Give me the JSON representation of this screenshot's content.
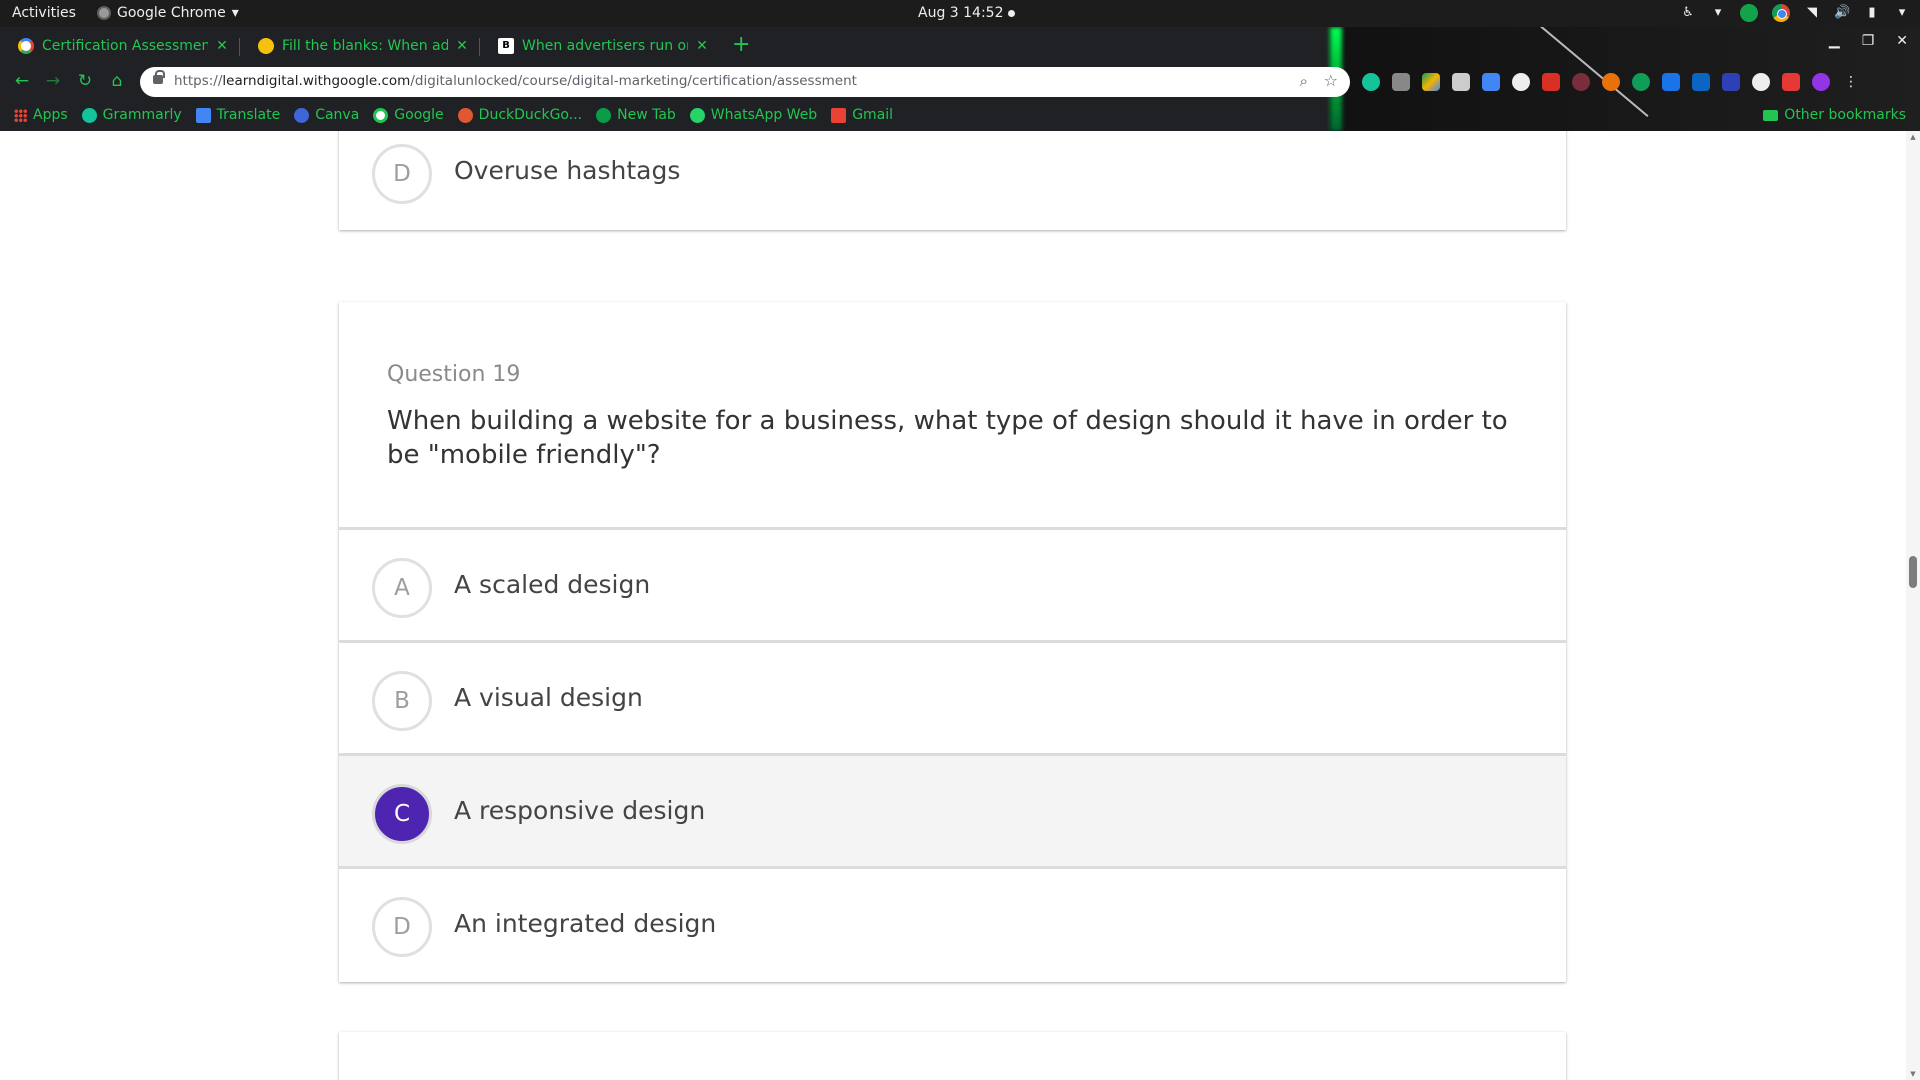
{
  "system_bar": {
    "activities": "Activities",
    "app_name": "Google Chrome",
    "clock": "Aug 3  14:52"
  },
  "browser": {
    "tabs": [
      {
        "title": "Certification Assessment",
        "favicon": "google-icon"
      },
      {
        "title": "Fill the blanks: When adv",
        "favicon": "yellow-circle-icon"
      },
      {
        "title": "When advertisers run onl",
        "favicon": "b-icon"
      }
    ],
    "url": {
      "scheme": "https://",
      "host": "learndigital.withgoogle.com",
      "path": "/digitalunlocked/course/digital-marketing/certification/assessment"
    },
    "bookmarks": [
      {
        "label": "Apps",
        "icon": "apps-grid-icon"
      },
      {
        "label": "Grammarly",
        "icon": "grammarly-icon"
      },
      {
        "label": "Translate",
        "icon": "translate-icon"
      },
      {
        "label": "Canva",
        "icon": "canva-icon"
      },
      {
        "label": "Google",
        "icon": "google-icon"
      },
      {
        "label": "DuckDuckGo...",
        "icon": "duckduckgo-icon"
      },
      {
        "label": "New Tab",
        "icon": "new-tab-icon"
      },
      {
        "label": "WhatsApp Web",
        "icon": "whatsapp-icon"
      },
      {
        "label": "Gmail",
        "icon": "gmail-icon"
      }
    ],
    "other_bookmarks": "Other bookmarks",
    "accent_color": "#23c552"
  },
  "quiz": {
    "previous_option": {
      "letter": "D",
      "text": "Overuse hashtags"
    },
    "question": {
      "number_label": "Question 19",
      "text": "When building a website for a business, what type of design should it have in order to be \"mobile friendly\"?",
      "options": [
        {
          "letter": "A",
          "text": "A scaled design",
          "selected": false
        },
        {
          "letter": "B",
          "text": "A visual design",
          "selected": false
        },
        {
          "letter": "C",
          "text": "A responsive design",
          "selected": true
        },
        {
          "letter": "D",
          "text": "An integrated design",
          "selected": false
        }
      ]
    },
    "selected_color": "#4e25b0"
  }
}
